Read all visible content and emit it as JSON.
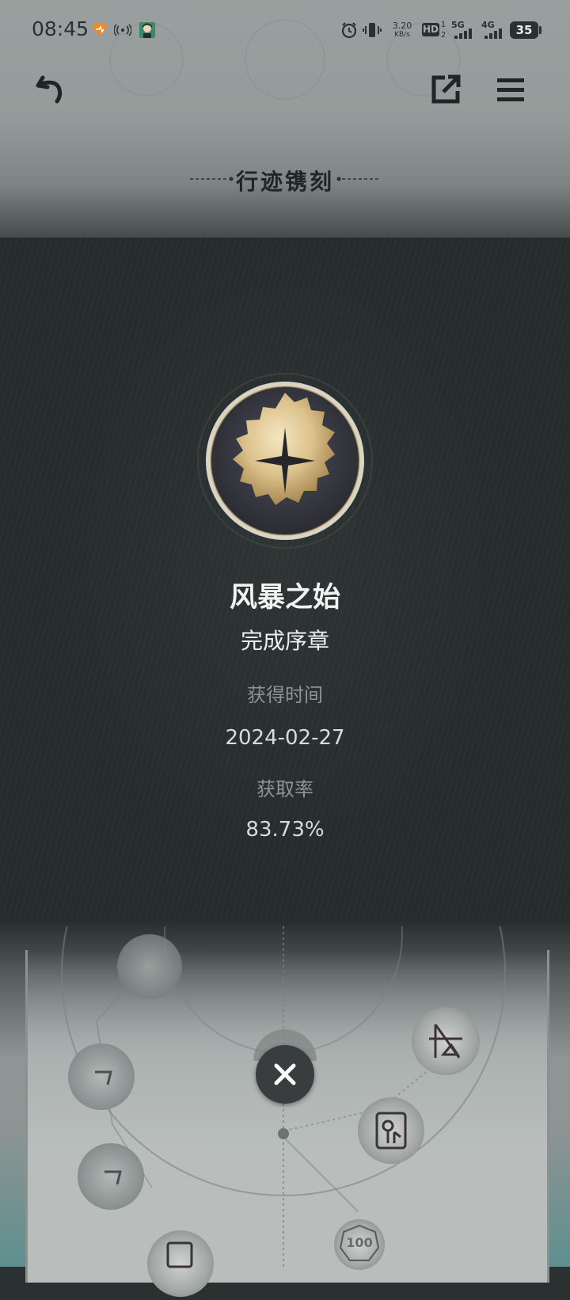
{
  "status_bar": {
    "time": "08:45",
    "net_speed_value": "3.20",
    "net_speed_unit": "KB/s",
    "hd_badge": "HD",
    "sim1": "1",
    "sim2": "2",
    "net_5g": "5G",
    "net_4g": "4G",
    "battery": "35",
    "icons": [
      "heart-app-icon",
      "wifi-calling-icon",
      "avatar-notification-icon",
      "alarm-icon",
      "vibrate-icon",
      "signal-5g-icon",
      "signal-4g-icon",
      "battery-icon"
    ]
  },
  "header": {
    "back_icon": "back-arrow-icon",
    "share_icon": "share-external-icon",
    "menu_icon": "menu-icon",
    "title": "行迹镌刻"
  },
  "achievement": {
    "name": "风暴之始",
    "description": "完成序章",
    "obtained_label": "获得时间",
    "obtained_date": "2024-02-27",
    "rate_label": "获取率",
    "rate_value": "83.73%"
  },
  "footer": {
    "close_icon": "close-icon",
    "badge_100": "100"
  },
  "colors": {
    "background_dark": "#262b2b",
    "header_gray": "#9aa09f",
    "text_light": "#f2f3f3",
    "label_gray": "#8e9494",
    "medal_gold": "#d9c089"
  }
}
